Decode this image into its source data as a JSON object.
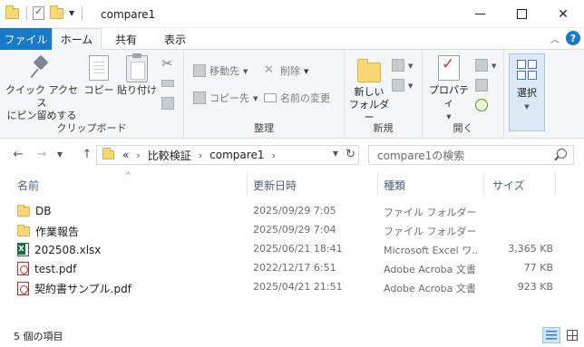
{
  "window": {
    "title": "compare1"
  },
  "ribbon_tabs": {
    "file": "ファイル",
    "home": "ホーム",
    "share": "共有",
    "view": "表示"
  },
  "ribbon": {
    "clipboard": {
      "pin_line1": "クイック アクセス",
      "pin_line2": "にピン留めする",
      "copy": "コピー",
      "paste": "貼り付け",
      "label": "クリップボード"
    },
    "organize": {
      "move_to": "移動先",
      "copy_to": "コピー先",
      "delete": "削除",
      "rename": "名前の変更",
      "label": "整理"
    },
    "new": {
      "new_folder_line1": "新しい",
      "new_folder_line2": "フォルダー",
      "label": "新規"
    },
    "open": {
      "properties": "プロパティ",
      "label": "開く"
    },
    "select": {
      "select": "選択"
    }
  },
  "address": {
    "overflow": "«",
    "crumbs": [
      "比較検証",
      "compare1"
    ],
    "search_placeholder": "compare1の検索"
  },
  "columns": {
    "name": "名前",
    "date": "更新日時",
    "type": "種類",
    "size": "サイズ"
  },
  "files": [
    {
      "name": "DB",
      "date": "2025/09/29 7:05",
      "type": "ファイル フォルダー",
      "size": "",
      "icon": "folder-icon"
    },
    {
      "name": "作業報告",
      "date": "2025/09/29 7:04",
      "type": "ファイル フォルダー",
      "size": "",
      "icon": "folder-icon"
    },
    {
      "name": "202508.xlsx",
      "date": "2025/06/21 18:41",
      "type": "Microsoft Excel ワ...",
      "size": "3,365 KB",
      "icon": "excel-file-icon"
    },
    {
      "name": "test.pdf",
      "date": "2022/12/17 6:51",
      "type": "Adobe Acroba 文書",
      "size": "77 KB",
      "icon": "pdf-file-icon"
    },
    {
      "name": "契約書サンプル.pdf",
      "date": "2025/04/21 21:51",
      "type": "Adobe Acroba 文書",
      "size": "923 KB",
      "icon": "pdf-file-icon"
    }
  ],
  "status": {
    "item_count": "5 個の項目"
  },
  "colors": {
    "accent": "#1979ca",
    "folder": "#f8d775",
    "column_header_text": "#4d6082"
  }
}
